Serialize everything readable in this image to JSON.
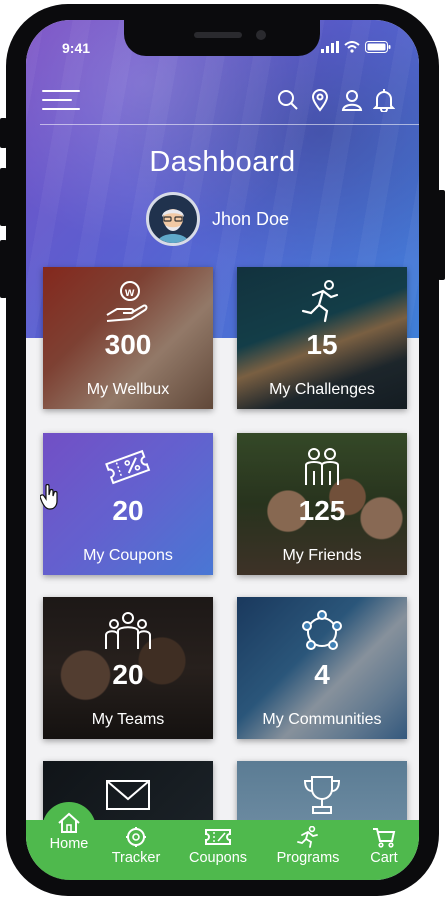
{
  "status": {
    "time": "9:41"
  },
  "header": {
    "title": "Dashboard"
  },
  "user": {
    "name": "Jhon Doe"
  },
  "tiles": [
    {
      "count": "300",
      "label": "My Wellbux",
      "icon": "hand-coin-icon"
    },
    {
      "count": "15",
      "label": "My Challenges",
      "icon": "runner-icon"
    },
    {
      "count": "20",
      "label": "My Coupons",
      "icon": "coupon-icon"
    },
    {
      "count": "125",
      "label": "My Friends",
      "icon": "friends-icon"
    },
    {
      "count": "20",
      "label": "My Teams",
      "icon": "team-icon"
    },
    {
      "count": "4",
      "label": "My Communities",
      "icon": "community-icon"
    },
    {
      "count": "",
      "label": "",
      "icon": "mail-icon"
    },
    {
      "count": "",
      "label": "",
      "icon": "trophy-icon"
    }
  ],
  "nav": [
    {
      "label": "Home",
      "icon": "home-icon"
    },
    {
      "label": "Tracker",
      "icon": "tracker-icon"
    },
    {
      "label": "Coupons",
      "icon": "coupon-icon"
    },
    {
      "label": "Programs",
      "icon": "programs-icon"
    },
    {
      "label": "Cart",
      "icon": "cart-icon"
    }
  ],
  "colors": {
    "header_gradient_start": "#7a4fc4",
    "header_gradient_end": "#3f7fd8",
    "nav_green": "#4fb94d",
    "coupons_tile": "#5a55c8"
  }
}
